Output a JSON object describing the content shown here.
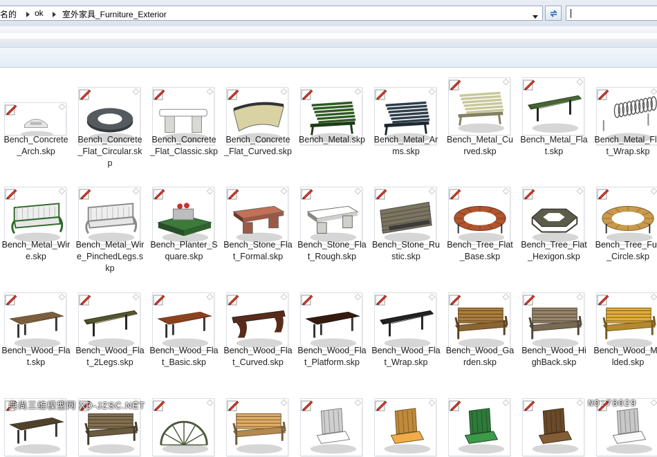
{
  "address_bar": {
    "crumbs": [
      "名的",
      "ok",
      "室外家具_Furniture_Exterior"
    ],
    "search_value": ""
  },
  "icons": {
    "refresh": "refresh-arrows-icon",
    "badge": "sketchup-file-icon",
    "crumb_separator": "chevron-right-icon",
    "dropdown": "chevron-down-icon"
  },
  "colors": {
    "toolbar_top": "#f6f8fb",
    "toolbar_bottom": "#dde5f0",
    "badge_red": "#c0392b"
  },
  "files": [
    {
      "label": "Bench_Concrete_Arch.skp",
      "kind": "arch",
      "color": "#b8b8b8"
    },
    {
      "label": "Bench_Concrete_Flat_Circular.skp",
      "kind": "ring",
      "color": "#555a5e"
    },
    {
      "label": "Bench_Concrete_Flat_Classic.skp",
      "kind": "stone",
      "color": "#d8d8d4"
    },
    {
      "label": "Bench_Concrete_Flat_Curved.skp",
      "kind": "curved",
      "color": "#d9d3a4"
    },
    {
      "label": "Bench_Metal.skp",
      "kind": "slats",
      "color": "#2f5a23"
    },
    {
      "label": "Bench_Metal_Arms.skp",
      "kind": "slats",
      "color": "#2e3d4a"
    },
    {
      "label": "Bench_Metal_Curved.skp",
      "kind": "slats",
      "color": "#c8c79a"
    },
    {
      "label": "Bench_Metal_Flat.skp",
      "kind": "flat",
      "color": "#3f5a2e"
    },
    {
      "label": "Bench_Metal_Flat_Wrap.skp",
      "kind": "wrap",
      "color": "#5a5a5a"
    },
    {
      "label": "Bench_Metal_Wire.skp",
      "kind": "wire",
      "color": "#2d6a2a"
    },
    {
      "label": "Bench_Metal_Wire_PinchedLegs.skp",
      "kind": "wire",
      "color": "#8a8a8a"
    },
    {
      "label": "Bench_Planter_Square.skp",
      "kind": "planter",
      "color": "#3c7a3a"
    },
    {
      "label": "Bench_Stone_Flat_Formal.skp",
      "kind": "block",
      "color": "#9a5a45"
    },
    {
      "label": "Bench_Stone_Flat_Rough.skp",
      "kind": "block",
      "color": "#cfcfcb"
    },
    {
      "label": "Bench_Stone_Rustic.skp",
      "kind": "rustic",
      "color": "#7a7460"
    },
    {
      "label": "Bench_Tree_Flat_Base.skp",
      "kind": "treering",
      "color": "#b0552e"
    },
    {
      "label": "Bench_Tree_Flat_Hexigon.skp",
      "kind": "hex",
      "color": "#5c5c4a"
    },
    {
      "label": "Bench_Tree_Full_Circle.skp",
      "kind": "treering",
      "color": "#c99a4c"
    },
    {
      "label": "Bench_Wood_Flat.skp",
      "kind": "woodflat",
      "color": "#8a6a45"
    },
    {
      "label": "Bench_Wood_Flat_2Legs.skp",
      "kind": "flat",
      "color": "#4a4a2a"
    },
    {
      "label": "Bench_Wood_Flat_Basic.skp",
      "kind": "woodflat",
      "color": "#9c4a22"
    },
    {
      "label": "Bench_Wood_Flat_Curved.skp",
      "kind": "woodcurved",
      "color": "#5a2a1a"
    },
    {
      "label": "Bench_Wood_Flat_Platform.skp",
      "kind": "woodflat",
      "color": "#3a1e12"
    },
    {
      "label": "Bench_Wood_Flat_Wrap.skp",
      "kind": "flat",
      "color": "#1e1e1e"
    },
    {
      "label": "Bench_Wood_Garden.skp",
      "kind": "garden",
      "color": "#8a6530"
    },
    {
      "label": "Bench_Wood_HighBack.skp",
      "kind": "garden",
      "color": "#7a6a55"
    },
    {
      "label": "Bench_Wood_Molded.skp",
      "kind": "garden",
      "color": "#b58a2e"
    },
    {
      "label": "",
      "kind": "woodflat",
      "color": "#5a4a30"
    },
    {
      "label": "",
      "kind": "garden",
      "color": "#6a5a40"
    },
    {
      "label": "",
      "kind": "wheel",
      "color": "#4a5a3a"
    },
    {
      "label": "",
      "kind": "garden",
      "color": "#b48a50"
    },
    {
      "label": "",
      "kind": "chair",
      "color": "#cfcfcf"
    },
    {
      "label": "",
      "kind": "chair",
      "color": "#c08a3a"
    },
    {
      "label": "",
      "kind": "chair",
      "color": "#2f7a3a"
    },
    {
      "label": "",
      "kind": "chair",
      "color": "#6a4a2a"
    },
    {
      "label": "",
      "kind": "chair",
      "color": "#c8c8c8"
    }
  ],
  "watermark": {
    "left": "典尚三维模型网 XD-JZSC.NET",
    "right": "NO:78029"
  }
}
